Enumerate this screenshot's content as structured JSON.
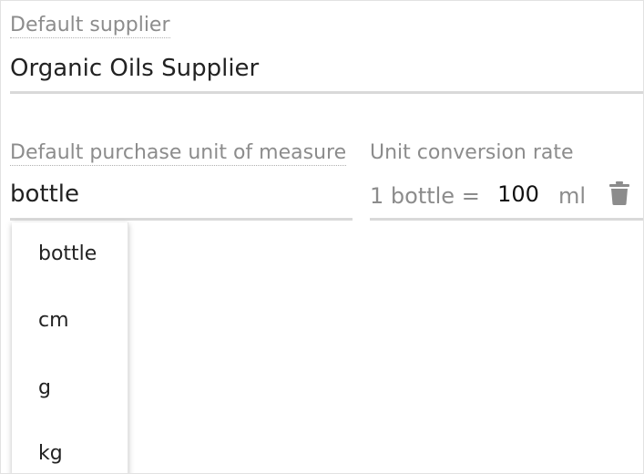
{
  "supplier": {
    "label": "Default supplier",
    "value": "Organic Oils Supplier"
  },
  "purchase_uom": {
    "label": "Default purchase unit of measure",
    "value": "bottle"
  },
  "conversion": {
    "label": "Unit conversion rate",
    "prefix": "1 bottle =",
    "rate": "100",
    "unit": "ml",
    "delete_icon": "trash-icon"
  },
  "uom_options": [
    "bottle",
    "cm",
    "g",
    "kg"
  ]
}
